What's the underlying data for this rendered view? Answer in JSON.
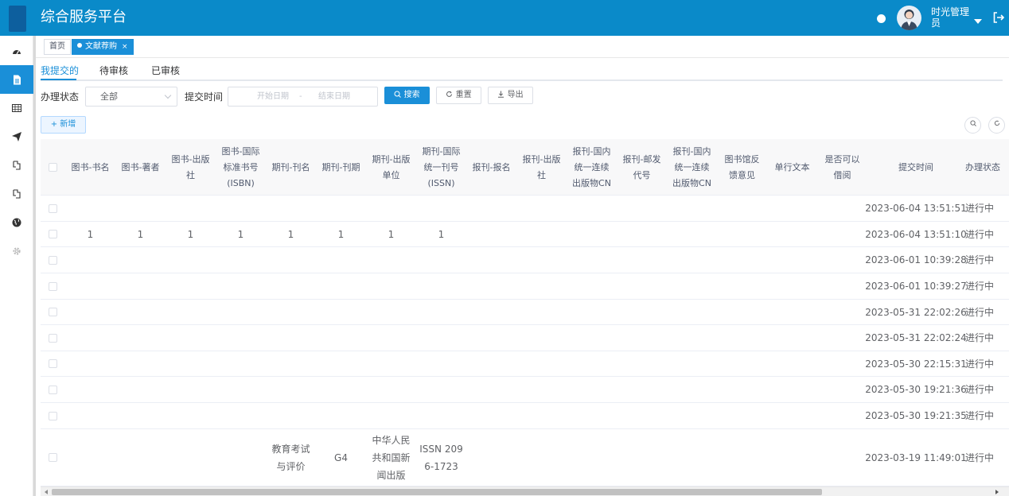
{
  "header": {
    "app_title": "综合服务平台",
    "user_name": "时光管理员",
    "icons": [
      "user-avatar",
      "chevron-down-icon",
      "logout-icon"
    ]
  },
  "sidebar": {
    "items": [
      {
        "icon": "dashboard-icon"
      },
      {
        "icon": "document-icon",
        "active": true
      },
      {
        "icon": "table-icon"
      },
      {
        "icon": "send-icon"
      },
      {
        "icon": "book-icon"
      },
      {
        "icon": "book-icon"
      },
      {
        "icon": "globe-icon"
      },
      {
        "icon": "gear-icon"
      }
    ]
  },
  "tags": {
    "home": "首页",
    "current": "文献荐购",
    "close": "×"
  },
  "subtabs": [
    "我提交的",
    "待审核",
    "已审核"
  ],
  "filters": {
    "status_label": "办理状态",
    "status_value": "全部",
    "time_label": "提交时间",
    "start_placeholder": "开始日期",
    "separator": "-",
    "end_placeholder": "结束日期",
    "search_btn": "搜索",
    "reset_btn": "重置",
    "export_btn": "导出",
    "add_btn": "新增"
  },
  "table": {
    "headers": [
      [
        "图书-书名"
      ],
      [
        "图书-著者"
      ],
      [
        "图书-出版",
        "社"
      ],
      [
        "图书-国际",
        "标准书号",
        "(ISBN)"
      ],
      [
        "期刊-刊名"
      ],
      [
        "期刊-刊期"
      ],
      [
        "期刊-出版",
        "单位"
      ],
      [
        "期刊-国际",
        "统一刊号",
        "(ISSN)"
      ],
      [
        "报刊-报名"
      ],
      [
        "报刊-出版",
        "社"
      ],
      [
        "报刊-国内",
        "统一连续",
        "出版物CN"
      ],
      [
        "报刊-邮发",
        "代号"
      ],
      [
        "报刊-国内",
        "统一连续",
        "出版物CN"
      ],
      [
        "图书馆反",
        "馈意见"
      ],
      [
        "单行文本"
      ],
      [
        "是否可以",
        "借阅"
      ],
      [
        "提交时间"
      ],
      [
        "办理状态"
      ]
    ],
    "rows": [
      {
        "cells": [
          [
            ""
          ],
          [
            ""
          ],
          [
            ""
          ],
          [
            ""
          ],
          [
            ""
          ],
          [
            ""
          ],
          [
            ""
          ],
          [
            ""
          ],
          [
            ""
          ],
          [
            ""
          ],
          [
            ""
          ],
          [
            ""
          ],
          [
            ""
          ],
          [
            ""
          ],
          [
            ""
          ],
          [
            ""
          ],
          [
            "2023-06-04 13:51:51"
          ],
          [
            "进行中"
          ]
        ]
      },
      {
        "cells": [
          [
            "1"
          ],
          [
            "1"
          ],
          [
            "1"
          ],
          [
            "1"
          ],
          [
            "1"
          ],
          [
            "1"
          ],
          [
            "1"
          ],
          [
            "1"
          ],
          [
            ""
          ],
          [
            ""
          ],
          [
            ""
          ],
          [
            ""
          ],
          [
            ""
          ],
          [
            ""
          ],
          [
            ""
          ],
          [
            ""
          ],
          [
            "2023-06-04 13:51:10"
          ],
          [
            "进行中"
          ]
        ]
      },
      {
        "cells": [
          [
            ""
          ],
          [
            ""
          ],
          [
            ""
          ],
          [
            ""
          ],
          [
            ""
          ],
          [
            ""
          ],
          [
            ""
          ],
          [
            ""
          ],
          [
            ""
          ],
          [
            ""
          ],
          [
            ""
          ],
          [
            ""
          ],
          [
            ""
          ],
          [
            ""
          ],
          [
            ""
          ],
          [
            ""
          ],
          [
            "2023-06-01 10:39:28"
          ],
          [
            "进行中"
          ]
        ]
      },
      {
        "cells": [
          [
            ""
          ],
          [
            ""
          ],
          [
            ""
          ],
          [
            ""
          ],
          [
            ""
          ],
          [
            ""
          ],
          [
            ""
          ],
          [
            ""
          ],
          [
            ""
          ],
          [
            ""
          ],
          [
            ""
          ],
          [
            ""
          ],
          [
            ""
          ],
          [
            ""
          ],
          [
            ""
          ],
          [
            ""
          ],
          [
            "2023-06-01 10:39:27"
          ],
          [
            "进行中"
          ]
        ]
      },
      {
        "cells": [
          [
            ""
          ],
          [
            ""
          ],
          [
            ""
          ],
          [
            ""
          ],
          [
            ""
          ],
          [
            ""
          ],
          [
            ""
          ],
          [
            ""
          ],
          [
            ""
          ],
          [
            ""
          ],
          [
            ""
          ],
          [
            ""
          ],
          [
            ""
          ],
          [
            ""
          ],
          [
            ""
          ],
          [
            ""
          ],
          [
            "2023-05-31 22:02:26"
          ],
          [
            "进行中"
          ]
        ]
      },
      {
        "cells": [
          [
            ""
          ],
          [
            ""
          ],
          [
            ""
          ],
          [
            ""
          ],
          [
            ""
          ],
          [
            ""
          ],
          [
            ""
          ],
          [
            ""
          ],
          [
            ""
          ],
          [
            ""
          ],
          [
            ""
          ],
          [
            ""
          ],
          [
            ""
          ],
          [
            ""
          ],
          [
            ""
          ],
          [
            ""
          ],
          [
            "2023-05-31 22:02:24"
          ],
          [
            "进行中"
          ]
        ]
      },
      {
        "cells": [
          [
            ""
          ],
          [
            ""
          ],
          [
            ""
          ],
          [
            ""
          ],
          [
            ""
          ],
          [
            ""
          ],
          [
            ""
          ],
          [
            ""
          ],
          [
            ""
          ],
          [
            ""
          ],
          [
            ""
          ],
          [
            ""
          ],
          [
            ""
          ],
          [
            ""
          ],
          [
            ""
          ],
          [
            ""
          ],
          [
            "2023-05-30 22:15:31"
          ],
          [
            "进行中"
          ]
        ]
      },
      {
        "cells": [
          [
            ""
          ],
          [
            ""
          ],
          [
            ""
          ],
          [
            ""
          ],
          [
            ""
          ],
          [
            ""
          ],
          [
            ""
          ],
          [
            ""
          ],
          [
            ""
          ],
          [
            ""
          ],
          [
            ""
          ],
          [
            ""
          ],
          [
            ""
          ],
          [
            ""
          ],
          [
            ""
          ],
          [
            ""
          ],
          [
            "2023-05-30 19:21:36"
          ],
          [
            "进行中"
          ]
        ]
      },
      {
        "cells": [
          [
            ""
          ],
          [
            ""
          ],
          [
            ""
          ],
          [
            ""
          ],
          [
            ""
          ],
          [
            ""
          ],
          [
            ""
          ],
          [
            ""
          ],
          [
            ""
          ],
          [
            ""
          ],
          [
            ""
          ],
          [
            ""
          ],
          [
            ""
          ],
          [
            ""
          ],
          [
            ""
          ],
          [
            ""
          ],
          [
            "2023-05-30 19:21:35"
          ],
          [
            "进行中"
          ]
        ]
      },
      {
        "cells": [
          [
            ""
          ],
          [
            ""
          ],
          [
            ""
          ],
          [
            ""
          ],
          [
            "教育考试",
            "与评价"
          ],
          [
            "G4"
          ],
          [
            "中华人民",
            "共和国新",
            "闻出版"
          ],
          [
            "ISSN 209",
            "6-1723"
          ],
          [
            ""
          ],
          [
            ""
          ],
          [
            ""
          ],
          [
            ""
          ],
          [
            ""
          ],
          [
            ""
          ],
          [
            ""
          ],
          [
            ""
          ],
          [
            "2023-03-19 11:49:01"
          ],
          [
            "进行中"
          ]
        ]
      }
    ]
  },
  "colors": {
    "header_bg": "#0a8ac9",
    "accent": "#1a8fd8"
  }
}
